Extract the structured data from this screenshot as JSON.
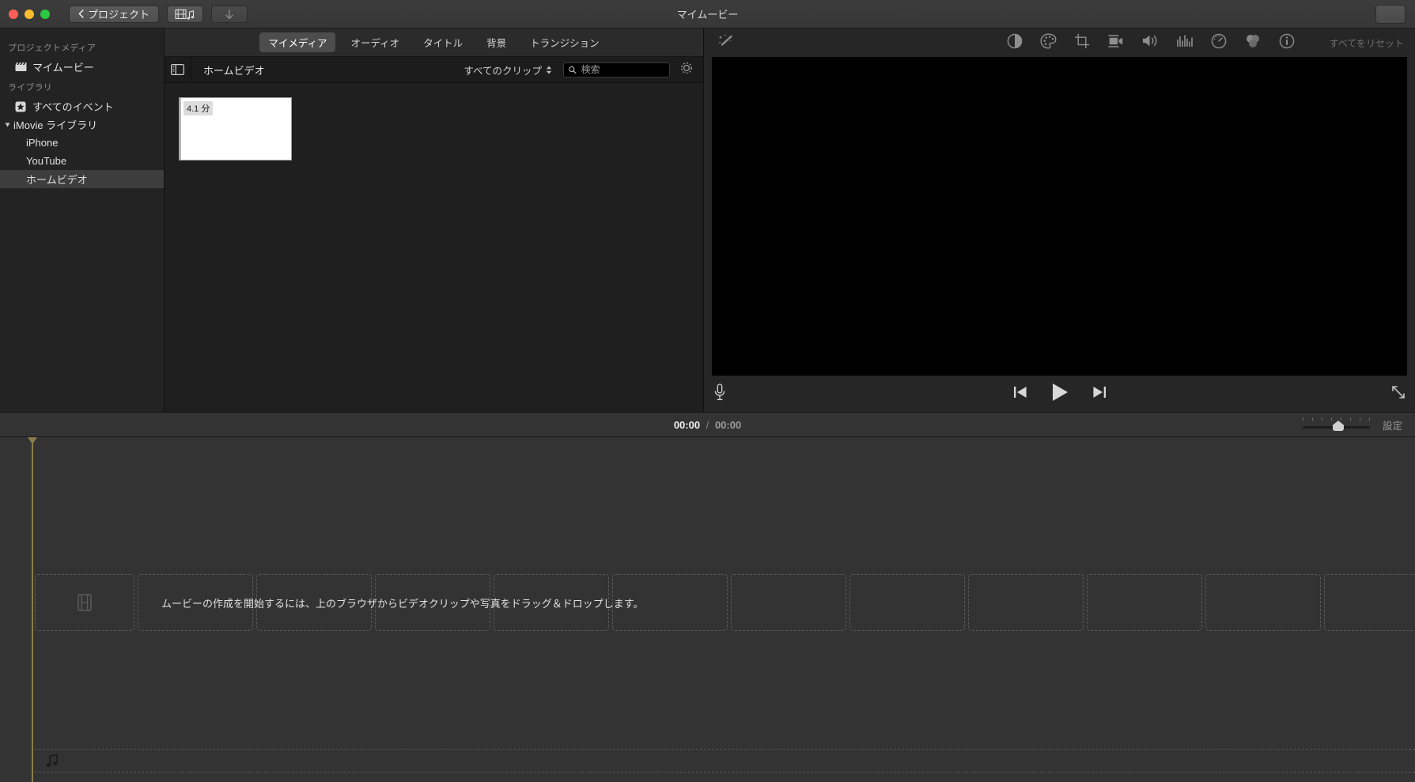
{
  "window": {
    "title": "マイムービー",
    "toolbar": {
      "back_label": "プロジェクト",
      "media_button_icon": "film-music-icon",
      "import_button_icon": "download-arrow-icon"
    }
  },
  "sidebar": {
    "sections": [
      {
        "header": "プロジェクトメディア",
        "items": [
          {
            "label": "マイムービー",
            "icon": "clapperboard-icon",
            "selected": false
          }
        ]
      },
      {
        "header": "ライブラリ",
        "items": [
          {
            "label": "すべてのイベント",
            "icon": "star-box-icon",
            "selected": false
          }
        ]
      }
    ],
    "library_root": "iMovie ライブラリ",
    "library_items": [
      {
        "label": "iPhone",
        "selected": false
      },
      {
        "label": "YouTube",
        "selected": false
      },
      {
        "label": "ホームビデオ",
        "selected": true
      }
    ]
  },
  "tabs": [
    {
      "label": "マイメディア",
      "active": true
    },
    {
      "label": "オーディオ",
      "active": false
    },
    {
      "label": "タイトル",
      "active": false
    },
    {
      "label": "背景",
      "active": false
    },
    {
      "label": "トランジション",
      "active": false
    }
  ],
  "browser": {
    "title": "ホームビデオ",
    "sidebar_toggle_icon": "sidebar-toggle-icon",
    "filter_label": "すべてのクリップ",
    "search": {
      "value": "",
      "placeholder": "検索",
      "icon": "search-icon"
    },
    "settings_icon": "gear-icon",
    "clips": [
      {
        "duration": "4.1 分",
        "selected": true
      }
    ]
  },
  "inspector": {
    "magic_icon": "magic-wand-icon",
    "reset_label": "すべてをリセット",
    "tools": [
      {
        "name": "color-balance-icon"
      },
      {
        "name": "color-correction-icon"
      },
      {
        "name": "crop-icon"
      },
      {
        "name": "stabilization-icon"
      },
      {
        "name": "volume-icon"
      },
      {
        "name": "equalizer-icon"
      },
      {
        "name": "speed-icon"
      },
      {
        "name": "filters-icon"
      },
      {
        "name": "info-icon"
      }
    ]
  },
  "player": {
    "mic_icon": "microphone-icon",
    "previous_icon": "skip-previous-icon",
    "play_icon": "play-icon",
    "next_icon": "skip-next-icon",
    "fullscreen_icon": "expand-diagonal-icon"
  },
  "timeline_toolbar": {
    "current_time": "00:00",
    "separator": "/",
    "total_time": "00:00",
    "settings_label": "設定"
  },
  "timeline": {
    "empty_message": "ムービーの作成を開始するには、上のブラウザからビデオクリップや写真をドラッグ＆ドロップします。",
    "placeholder_icon": "film-strip-icon",
    "audio_icon": "music-note-icon",
    "dropzone_count": 12
  },
  "colors": {
    "playhead": "#8a7c4e",
    "accent_selection": "#3d3d3d",
    "window_bg": "#262626",
    "timeline_bg": "#333333"
  }
}
